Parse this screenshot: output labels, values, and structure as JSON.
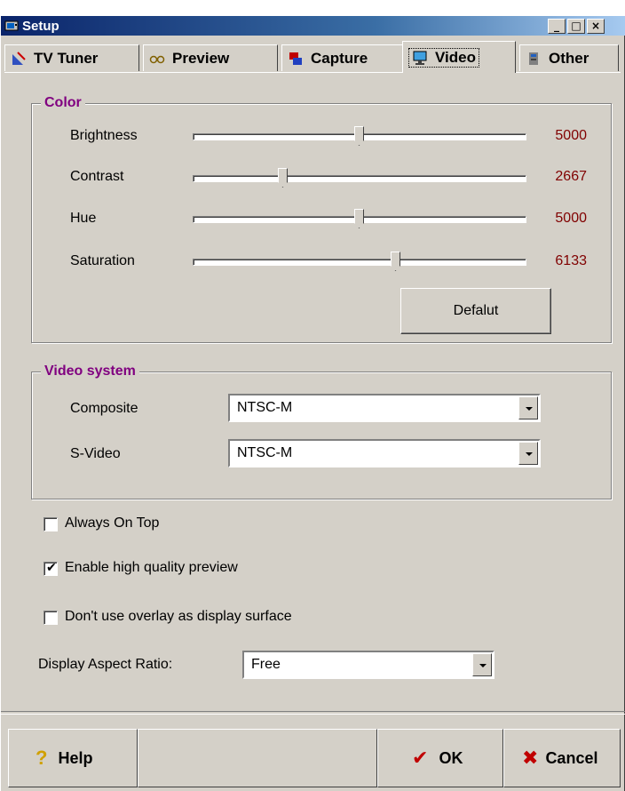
{
  "window": {
    "title": "Setup"
  },
  "titlebar_buttons": {
    "minimize": "_",
    "maximize": "□",
    "close": "×"
  },
  "tabs": [
    {
      "label": "TV Tuner",
      "icon": "satellite-dish-icon"
    },
    {
      "label": "Preview",
      "icon": "glasses-icon"
    },
    {
      "label": "Capture",
      "icon": "capture-icon"
    },
    {
      "label": "Video",
      "icon": "monitor-icon"
    },
    {
      "label": "Other",
      "icon": "tools-icon"
    }
  ],
  "active_tab": "Video",
  "color_group": {
    "title": "Color",
    "sliders": [
      {
        "label": "Brightness",
        "value": "5000",
        "fraction": 0.5
      },
      {
        "label": "Contrast",
        "value": "2667",
        "fraction": 0.27
      },
      {
        "label": "Hue",
        "value": "5000",
        "fraction": 0.5
      },
      {
        "label": "Saturation",
        "value": "6133",
        "fraction": 0.61
      }
    ],
    "default_button": "Defalut"
  },
  "video_system": {
    "title": "Video system",
    "composite": {
      "label": "Composite",
      "value": "NTSC-M"
    },
    "svideo": {
      "label": "S-Video",
      "value": "NTSC-M"
    }
  },
  "options": {
    "always_on_top": {
      "label": "Always On Top",
      "checked": false
    },
    "high_quality_preview": {
      "label": "Enable high quality preview",
      "checked": true
    },
    "no_overlay": {
      "label": "Don't use overlay as display surface",
      "checked": false
    }
  },
  "aspect_ratio": {
    "label": "Display Aspect Ratio:",
    "value": "Free"
  },
  "buttons": {
    "help": "Help",
    "ok": "OK",
    "cancel": "Cancel"
  },
  "colors": {
    "group_title": "#800080",
    "slider_value": "#800000",
    "face": "#d4d0c8"
  }
}
